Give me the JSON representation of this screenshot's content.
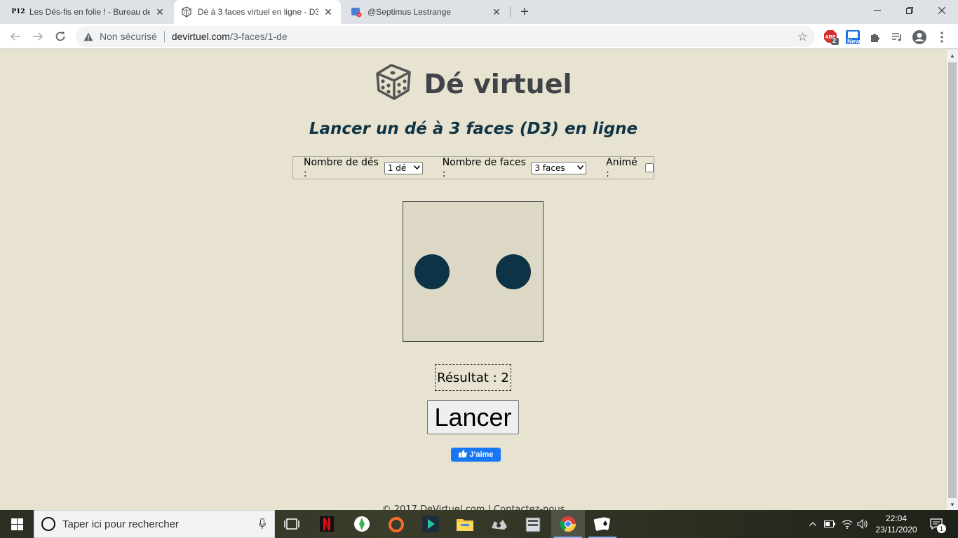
{
  "browser": {
    "tabs": [
      {
        "title": "Les Dés-fis en folie ! - Bureau des",
        "favicon": "P12"
      },
      {
        "title": "Dé à 3 faces virtuel en ligne - D3",
        "favicon": "dice-icon"
      },
      {
        "title": "@Septimus Lestrange",
        "favicon": "messenger-icon"
      }
    ],
    "address": {
      "security_label": "Non sécurisé",
      "host": "devirtuel.com",
      "path": "/3-faces/1-de"
    },
    "extensions": {
      "adblock_badge": "2",
      "new_badge": "New"
    }
  },
  "page": {
    "site_title": "Dé virtuel",
    "subtitle": "Lancer un dé à 3 faces (D3) en ligne",
    "options": {
      "dice_count_label": "Nombre de dés :",
      "dice_count_value": "1 dé",
      "faces_label": "Nombre de faces :",
      "faces_value": "3 faces",
      "animated_label": "Animé :",
      "animated_checked": false
    },
    "die": {
      "value": 2,
      "pip_color": "#0c3346",
      "face_color": "#dcd8c5"
    },
    "result_text": "Résultat : 2",
    "roll_button": "Lancer",
    "like_button": "J'aime",
    "footer": "© 2017 DeVirtuel.com | Contactez-nous"
  },
  "taskbar": {
    "search_placeholder": "Taper ici pour rechercher",
    "time": "22:04",
    "date": "23/11/2020",
    "notification_count": "1"
  }
}
